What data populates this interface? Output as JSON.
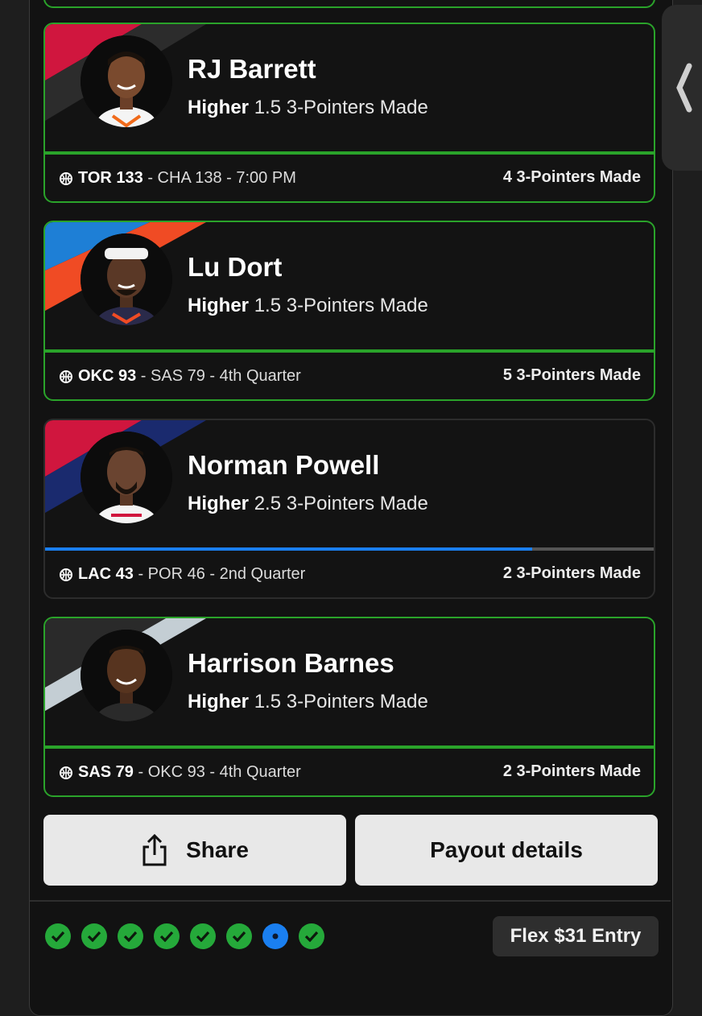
{
  "picks": [
    {
      "player": "RJ Barrett",
      "direction": "Higher",
      "line": "1.5 3-Pointers Made",
      "game_team": "TOR 133",
      "game_rest": " - CHA 138 - 7:00 PM",
      "result": "4 3-Pointers Made",
      "status": "won",
      "stripe_colors": [
        "#d0163e",
        "#3a3a3a"
      ]
    },
    {
      "player": "Lu Dort",
      "direction": "Higher",
      "line": "1.5 3-Pointers Made",
      "game_team": "OKC 93",
      "game_rest": " - SAS 79 - 4th Quarter",
      "result": "5 3-Pointers Made",
      "status": "won",
      "stripe_colors": [
        "#1e7fd6",
        "#f04b24"
      ]
    },
    {
      "player": "Norman Powell",
      "direction": "Higher",
      "line": "2.5 3-Pointers Made",
      "game_team": "LAC 43",
      "game_rest": " - POR 46 - 2nd Quarter",
      "result": "2 3-Pointers Made",
      "status": "live",
      "progress": 0.8,
      "stripe_colors": [
        "#d0163e",
        "#1a2a6e"
      ]
    },
    {
      "player": "Harrison Barnes",
      "direction": "Higher",
      "line": "1.5 3-Pointers Made",
      "game_team": "SAS 79",
      "game_rest": " - OKC 93 - 4th Quarter",
      "result": "2 3-Pointers Made",
      "status": "won",
      "stripe_colors": [
        "#c4ced4",
        "#2a2a2a"
      ]
    }
  ],
  "buttons": {
    "share": "Share",
    "payout": "Payout details"
  },
  "pick_status": [
    "won",
    "won",
    "won",
    "won",
    "won",
    "won",
    "live",
    "won"
  ],
  "entry_label": "Flex $31 Entry",
  "colors": {
    "won": "#25a93a",
    "live": "#1a7ff0",
    "border_won": "#2aa32a"
  }
}
